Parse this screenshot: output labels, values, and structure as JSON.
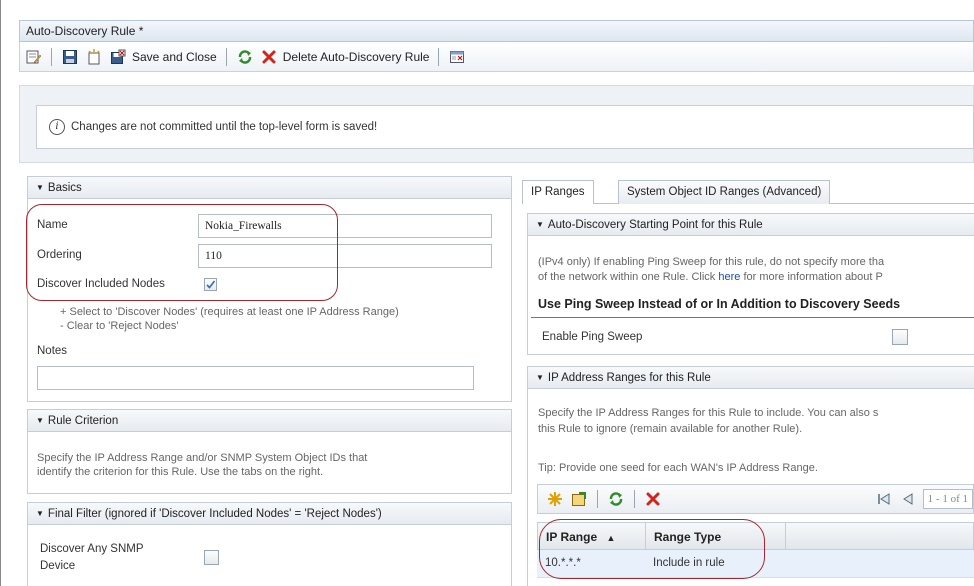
{
  "window": {
    "title": "Auto-Discovery Rule *"
  },
  "toolbar": {
    "save_close_label": "Save and Close",
    "delete_label": "Delete Auto-Discovery Rule"
  },
  "info": {
    "message": "Changes are not committed until the top-level form is saved!"
  },
  "basics": {
    "header": "Basics",
    "name_label": "Name",
    "name_value": "Nokia_Firewalls",
    "ordering_label": "Ordering",
    "ordering_value": "110",
    "discover_label": "Discover Included Nodes",
    "discover_checked": true,
    "hint1": "+ Select to 'Discover Nodes' (requires at least one IP Address Range)",
    "hint2": "- Clear to 'Reject Nodes'",
    "notes_label": "Notes",
    "notes_value": ""
  },
  "rule_criterion": {
    "header": "Rule Criterion",
    "line1": "Specify the IP Address Range and/or SNMP System Object IDs that",
    "line2": "identify the criterion for this Rule. Use the tabs on the right."
  },
  "final_filter": {
    "header": "Final Filter (ignored if 'Discover Included Nodes' = 'Reject Nodes')",
    "snmp_label_1": "Discover Any SNMP",
    "snmp_label_2": "Device"
  },
  "tabs": [
    {
      "label": "IP Ranges",
      "active": true
    },
    {
      "label": "System Object ID Ranges (Advanced)",
      "active": false
    }
  ],
  "starting_point": {
    "header": "Auto-Discovery Starting Point for this Rule",
    "line1": "(IPv4 only) If enabling Ping Sweep for this rule, do not specify more tha",
    "line2_pre": "of the network within one Rule. Click ",
    "line2_link": "here",
    "line2_post": " for more information about P",
    "bold_heading": "Use Ping Sweep Instead of or In Addition to Discovery Seeds",
    "enable_label": "Enable Ping Sweep"
  },
  "ip_ranges_section": {
    "header": "IP Address Ranges for this Rule",
    "line1": "Specify the IP Address Ranges for this Rule to include. You can also s",
    "line2": "this Rule to ignore (remain available for another Rule).",
    "tip": "Tip: Provide one seed for each WAN's IP Address Range.",
    "pager": "1 - 1 of 1"
  },
  "table": {
    "columns": [
      "IP Range",
      "Range Type"
    ],
    "sort_indicator": "▲",
    "rows": [
      {
        "ip_range": "10.*.*.*",
        "range_type": "Include in rule"
      }
    ]
  },
  "colors": {
    "highlight": "#a0282e",
    "link": "#1a4fa0",
    "row_bg": "#e8f0fb"
  }
}
